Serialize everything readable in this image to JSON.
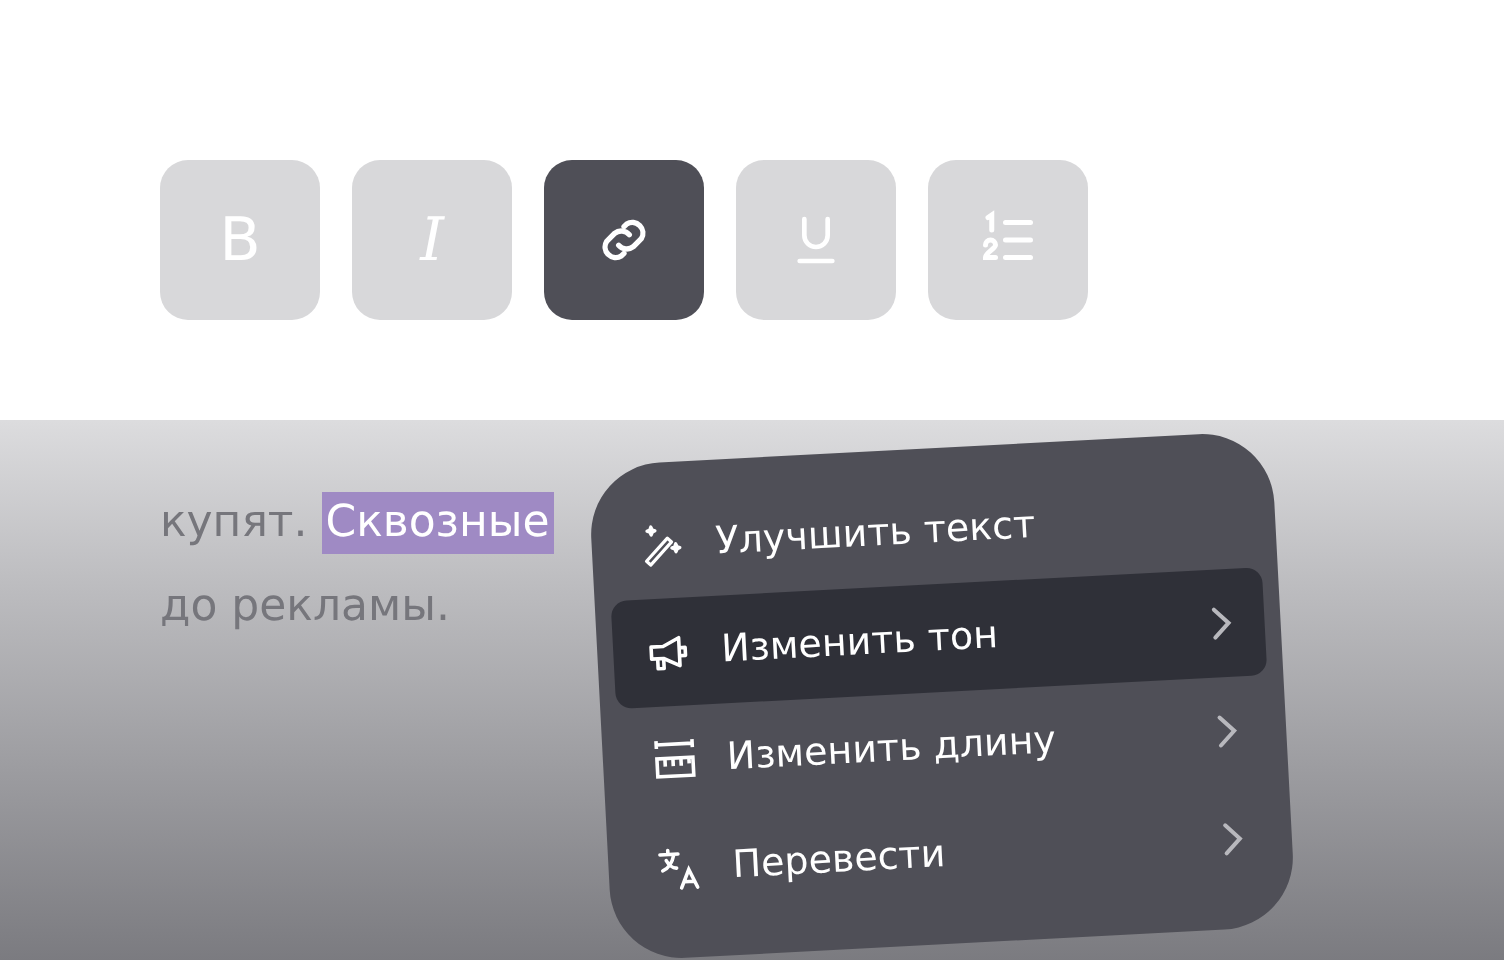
{
  "toolbar": [
    {
      "kind": "bold",
      "label": "B",
      "selected": false
    },
    {
      "kind": "italic",
      "label": "I",
      "selected": false
    },
    {
      "kind": "link",
      "selected": true
    },
    {
      "kind": "underline",
      "selected": false
    },
    {
      "kind": "list",
      "selected": false
    }
  ],
  "editor": {
    "line_2_before": "купят.",
    "highlighted": "Сквозные",
    "line_3": "до рекламы."
  },
  "menu": {
    "items": [
      {
        "kind": "wand",
        "label": "Улучшить текст",
        "submenu": false,
        "selected": false
      },
      {
        "kind": "megaphone",
        "label": "Изменить тон",
        "submenu": true,
        "selected": true
      },
      {
        "kind": "ruler",
        "label": "Изменить длину",
        "submenu": true,
        "selected": false
      },
      {
        "kind": "translate",
        "label": "Перевести",
        "submenu": true,
        "selected": false
      }
    ]
  }
}
